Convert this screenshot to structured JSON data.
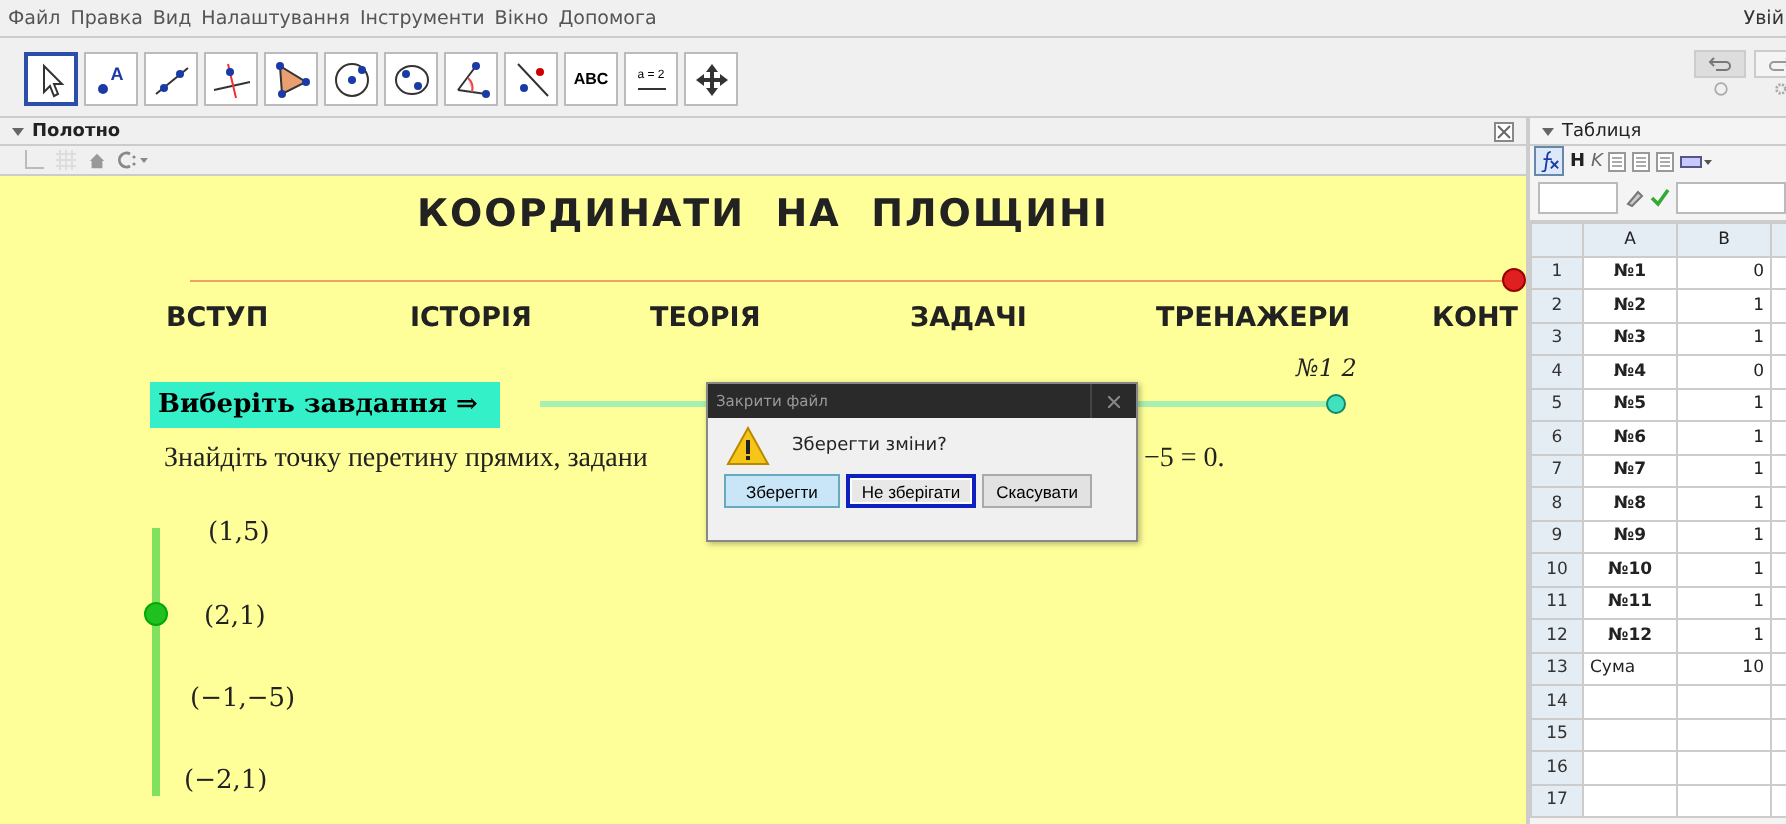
{
  "menu": [
    "Файл",
    "Правка",
    "Вид",
    "Налаштування",
    "Інструменти",
    "Вікно",
    "Допомога"
  ],
  "account_link": "Увій",
  "tools": [
    {
      "kind": "move",
      "selected": true
    },
    {
      "kind": "point",
      "label": "A",
      "selected": false
    },
    {
      "kind": "line",
      "selected": false
    },
    {
      "kind": "perpendicular",
      "selected": false
    },
    {
      "kind": "polygon",
      "selected": false
    },
    {
      "kind": "circle",
      "selected": false
    },
    {
      "kind": "conic",
      "selected": false
    },
    {
      "kind": "angle",
      "selected": false
    },
    {
      "kind": "reflect",
      "selected": false
    },
    {
      "kind": "text",
      "label": "ABC",
      "selected": false
    },
    {
      "kind": "slider",
      "label": "a = 2",
      "selected": false
    },
    {
      "kind": "move-view",
      "selected": false
    }
  ],
  "graphics_panel": {
    "title": "Полотно"
  },
  "canvas": {
    "title": "КООРДИНАТИ  НА  ПЛОЩИНІ",
    "nav": [
      "ВСТУП",
      "ІСТОРІЯ",
      "ТЕОРІЯ",
      "ЗАДАЧІ",
      "ТРЕНАЖЕРИ",
      "КОНТ"
    ],
    "task_number": "№1 2",
    "choose_button": "Виберіть завдання ⇒",
    "task_slider": {
      "level": 1
    },
    "question_start": "Знайдіть точку перетину прямих, задани",
    "question_end": "−5 = 0.",
    "answer_slider": {
      "level": 0.67
    },
    "answers": [
      "(1,5)",
      "(2,1)",
      "(−1,−5)",
      "(−2,1)"
    ]
  },
  "dialog": {
    "title": "Закрити файл",
    "message": "Зберегти зміни?",
    "buttons": [
      {
        "label": "Зберегти",
        "kind": "default",
        "focused": false
      },
      {
        "label": "Не зберігати",
        "kind": "normal",
        "focused": true
      },
      {
        "label": "Скасувати",
        "kind": "normal",
        "focused": false
      }
    ]
  },
  "spreadsheet_panel": {
    "title": "Таблиця",
    "bold_button": "H",
    "italic_button": "K",
    "columns": [
      "A",
      "B"
    ],
    "rows": [
      {
        "number": "1",
        "a": "№1",
        "b": "0"
      },
      {
        "number": "2",
        "a": "№2",
        "b": "1"
      },
      {
        "number": "3",
        "a": "№3",
        "b": "1"
      },
      {
        "number": "4",
        "a": "№4",
        "b": "0"
      },
      {
        "number": "5",
        "a": "№5",
        "b": "1"
      },
      {
        "number": "6",
        "a": "№6",
        "b": "1"
      },
      {
        "number": "7",
        "a": "№7",
        "b": "1"
      },
      {
        "number": "8",
        "a": "№8",
        "b": "1"
      },
      {
        "number": "9",
        "a": "№9",
        "b": "1"
      },
      {
        "number": "10",
        "a": "№10",
        "b": "1"
      },
      {
        "number": "11",
        "a": "№11",
        "b": "1"
      },
      {
        "number": "12",
        "a": "№12",
        "b": "1"
      },
      {
        "number": "13",
        "a": "Сума",
        "b": "10",
        "kind": "total"
      },
      {
        "number": "14"
      },
      {
        "number": "15"
      },
      {
        "number": "16"
      },
      {
        "number": "17"
      }
    ]
  }
}
